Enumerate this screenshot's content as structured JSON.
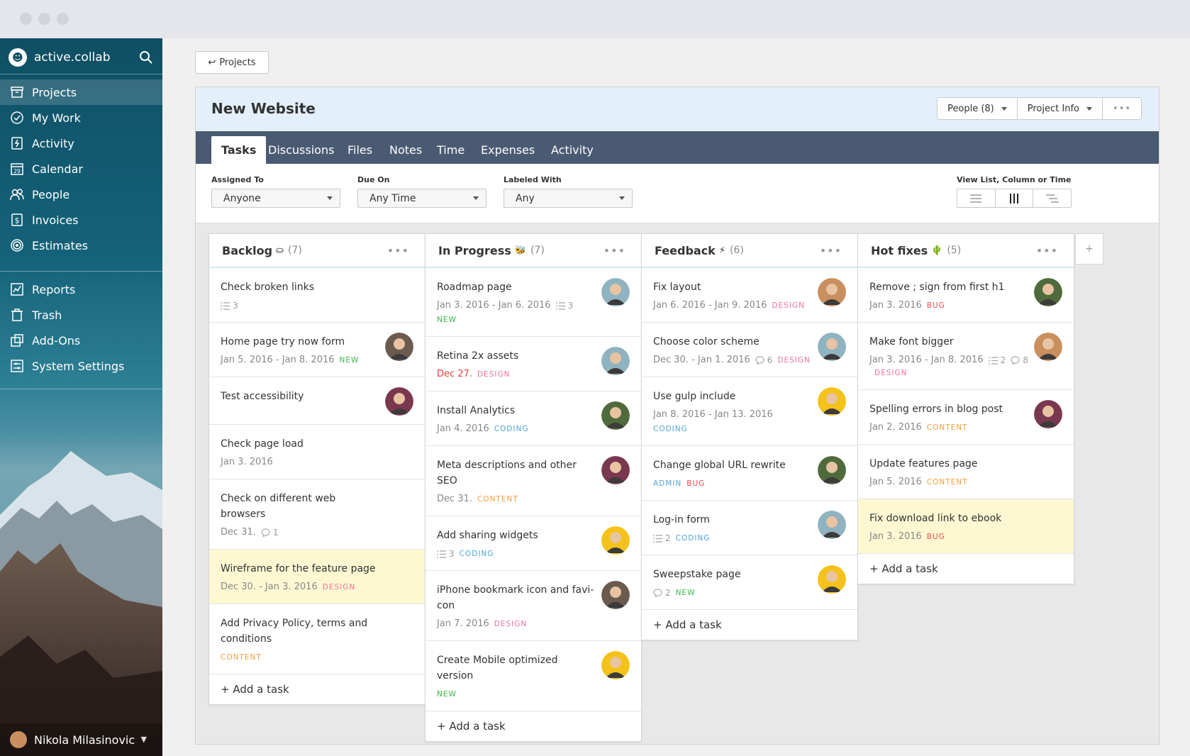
{
  "app": {
    "name": "active.collab"
  },
  "sidebar": {
    "items": [
      {
        "label": "Projects",
        "icon": "projects-icon",
        "active": true
      },
      {
        "label": "My Work",
        "icon": "check-circle-icon"
      },
      {
        "label": "Activity",
        "icon": "activity-icon"
      },
      {
        "label": "Calendar",
        "icon": "calendar-icon",
        "badge": "29"
      },
      {
        "label": "People",
        "icon": "people-icon"
      },
      {
        "label": "Invoices",
        "icon": "invoice-icon"
      },
      {
        "label": "Estimates",
        "icon": "estimates-icon"
      },
      {
        "label": "Reports",
        "icon": "reports-icon"
      },
      {
        "label": "Trash",
        "icon": "trash-icon"
      },
      {
        "label": "Add-Ons",
        "icon": "addons-icon"
      },
      {
        "label": "System Settings",
        "icon": "settings-icon"
      }
    ],
    "user": {
      "name": "Nikola Milasinovic"
    }
  },
  "back_button": {
    "label": "Projects",
    "icon": "return-arrow-icon"
  },
  "project": {
    "title": "New Website",
    "buttons": {
      "people": "People (8)",
      "info": "Project Info",
      "more": "•••"
    }
  },
  "tabs": [
    "Tasks",
    "Discussions",
    "Files",
    "Notes",
    "Time",
    "Expenses",
    "Activity"
  ],
  "active_tab": "Tasks",
  "filters": {
    "assigned": {
      "label": "Assigned To",
      "value": "Anyone"
    },
    "due": {
      "label": "Due On",
      "value": "Any Time"
    },
    "labeled": {
      "label": "Labeled With",
      "value": "Any"
    },
    "view": {
      "label": "View List, Column or Time",
      "active": "column"
    }
  },
  "add_task_label": "+ Add a task",
  "add_column_label": "+",
  "columns": [
    {
      "title": "Backlog",
      "icon": "⛀",
      "count": "(7)",
      "tasks": [
        {
          "title": "Check broken links",
          "subtasks": "3"
        },
        {
          "title": "Home page try now form",
          "date": "Jan 5. 2016 - Jan 8. 2016",
          "labels": [
            "NEW"
          ],
          "avatar": "#6b5a4e"
        },
        {
          "title": "Test accessibility",
          "avatar": "#7a3850"
        },
        {
          "title": "Check page load",
          "date": "Jan 3. 2016"
        },
        {
          "title": "Check on different web browsers",
          "date": "Dec 31.",
          "comments": "1"
        },
        {
          "title": "Wireframe for the feature page",
          "date": "Dec 30. - Jan 3. 2016",
          "labels": [
            "DESIGN"
          ],
          "highlight": true
        },
        {
          "title": "Add Privacy Policy, terms and conditions",
          "labels": [
            "CONTENT"
          ]
        }
      ]
    },
    {
      "title": "In Progress",
      "icon": "🐝",
      "count": "(7)",
      "tasks": [
        {
          "title": "Roadmap page",
          "date": "Jan 3. 2016 - Jan 6. 2016",
          "subtasks": "3",
          "labels": [
            "NEW"
          ],
          "labels_newline": true,
          "avatar": "#8fb3c0"
        },
        {
          "title": "Retina 2x assets",
          "date": "Dec 27.",
          "date_red": true,
          "labels": [
            "DESIGN"
          ],
          "avatar": "#8fb3c0"
        },
        {
          "title": "Install Analytics",
          "date": "Jan 4. 2016",
          "labels": [
            "CODING"
          ],
          "avatar": "#4f6b3c"
        },
        {
          "title": "Meta descriptions and other SEO",
          "date": "Dec 31.",
          "labels": [
            "CONTENT"
          ],
          "avatar": "#7a3850"
        },
        {
          "title": "Add sharing widgets",
          "subtasks": "3",
          "labels": [
            "CODING"
          ],
          "avatar": "#f4c21a"
        },
        {
          "title": "iPhone bookmark icon and favi-con",
          "date": "Jan 7. 2016",
          "labels": [
            "DESIGN"
          ],
          "avatar": "#6b5a4e"
        },
        {
          "title": "Create Mobile optimized version",
          "labels": [
            "NEW"
          ],
          "avatar": "#f4c21a"
        }
      ]
    },
    {
      "title": "Feedback",
      "icon": "⚡",
      "count": "(6)",
      "tasks": [
        {
          "title": "Fix layout",
          "date": "Jan 6. 2016 - Jan 9. 2016",
          "labels": [
            "DESIGN"
          ],
          "avatar": "#c98f5e"
        },
        {
          "title": "Choose color scheme",
          "date": "Dec 30. - Jan 1. 2016",
          "comments": "6",
          "labels": [
            "DESIGN"
          ],
          "avatar": "#8fb3c0"
        },
        {
          "title": "Use gulp include",
          "date": "Jan 8. 2016 - Jan 13. 2016",
          "labels": [
            "CODING"
          ],
          "labels_newline": true,
          "avatar": "#f4c21a"
        },
        {
          "title": "Change global URL rewrite",
          "labels": [
            "ADMIN",
            "BUG"
          ],
          "avatar": "#4f6b3c"
        },
        {
          "title": "Log-in form",
          "subtasks": "2",
          "labels": [
            "CODING"
          ],
          "avatar": "#8fb3c0"
        },
        {
          "title": "Sweepstake page",
          "comments": "2",
          "labels": [
            "NEW"
          ],
          "avatar": "#f4c21a"
        }
      ]
    },
    {
      "title": "Hot fixes",
      "icon": "🌵",
      "count": "(5)",
      "tasks": [
        {
          "title": "Remove ; sign from first h1",
          "date": "Jan 3. 2016",
          "labels": [
            "BUG"
          ],
          "avatar": "#4f6b3c"
        },
        {
          "title": "Make font bigger",
          "date": "Jan 3. 2016 - Jan 8. 2016",
          "subtasks": "2",
          "comments": "8",
          "labels": [
            "DESIGN"
          ],
          "avatar": "#c98f5e"
        },
        {
          "title": "Spelling errors in blog post",
          "date": "Jan 2. 2016",
          "labels": [
            "CONTENT"
          ],
          "avatar": "#7a3850"
        },
        {
          "title": "Update features page",
          "date": "Jan 5. 2016",
          "labels": [
            "CONTENT"
          ]
        },
        {
          "title": "Fix download link to ebook",
          "date": "Jan 3. 2016",
          "labels": [
            "BUG"
          ],
          "highlight": true
        }
      ]
    }
  ]
}
